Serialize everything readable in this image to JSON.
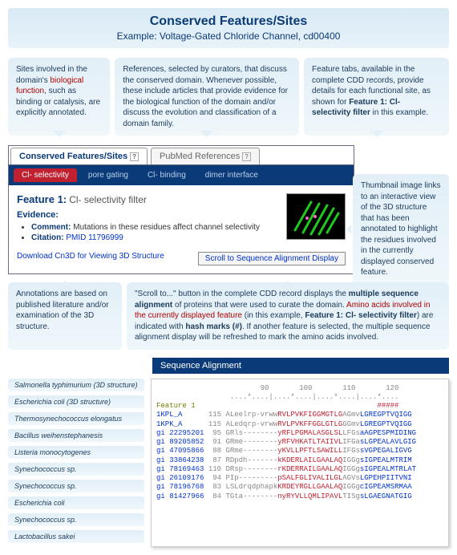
{
  "header": {
    "title": "Conserved Features/Sites",
    "subtitle": "Example: Voltage-Gated Chloride Channel, cd00400"
  },
  "callouts": {
    "top_left": {
      "pre": "Sites involved in the domain's ",
      "hl": "biological function",
      "post": ", such as binding or catalysis, are explicitly annotated."
    },
    "top_mid": "References, selected by curators, that discuss the conserved domain.  Whenever possible, these include articles that provide evidence for the biological function of the domain and/or discuss the evolution and classification of a domain family.",
    "top_right": {
      "pre": "Feature tabs, available in the complete CDD records, provide details for each functional site, as shown for ",
      "bold": "Feature 1: Cl- selectivity filter",
      "post": " in this example."
    },
    "thumb": "Thumbnail image links to an interactive view of the 3D structure that has been annotated to highlight the residues involved in the currently displayed conserved feature.",
    "mid_left": "Annotations are based on published literature and/or examination of the 3D structure.",
    "mid_right": "\"Scroll to...\"  button in the complete CDD record displays the multiple sequence alignment of proteins that were used to curate the domain.  Amino acids involved in the currently displayed feature (in this example, Feature 1: Cl- selectivity filter) are indicated with hash marks (#).  If another feature is selected, the multiple sequence alignment display will be refreshed to mark the amino acids involved."
  },
  "outer_tabs": [
    {
      "label": "Conserved Features/Sites",
      "active": true
    },
    {
      "label": "PubMed References",
      "active": false
    }
  ],
  "inner_tabs": [
    {
      "label": "Cl- selectivity",
      "active": true
    },
    {
      "label": "pore gating"
    },
    {
      "label": "Cl- binding"
    },
    {
      "label": "dimer interface"
    }
  ],
  "feature": {
    "label": "Feature 1:",
    "name": "Cl- selectivity filter",
    "evidence_label": "Evidence:",
    "comment_label": "Comment:",
    "comment": "Mutations in these residues affect channel selectivity",
    "citation_label": "Citation:",
    "citation": "PMID 11796999",
    "download_link": "Download Cn3D for Viewing 3D Structure",
    "scroll_button": "Scroll to Sequence Alignment Display"
  },
  "seq_band": "Sequence Alignment",
  "species": [
    "Salmonella typhimurium (3D structure)",
    "Escherichia coli (3D structure)",
    "Thermosynechococcus elongatus",
    "Bacillus weihenstephanesis",
    "Listeria monocytogenes",
    "Synechococcus sp.",
    "Synechococcus sp.",
    "Escherichia coli",
    "Synechococcus sp.",
    "Lactobacillus sakei"
  ],
  "alignment": {
    "ruler1": "                        90       100       110       120",
    "ruler2": "                 ....*....|....*....|....*....|....*....",
    "feat": "Feature 1                                          #####",
    "rows": [
      {
        "id": "1KPL_A     ",
        "pos": "115",
        "pre": "ALeelrp-vrww",
        "red": "RVLPVKFIGGMGTLG",
        "mid": "AGmv",
        "suf": "LGREGPTVQIGG"
      },
      {
        "id": "1KPK_A     ",
        "pos": "115",
        "pre": "ALedqrp-vrww",
        "red": "RVLPVKFFGGLGTLG",
        "mid": "GGmv",
        "suf": "LGREGPTVQIGG"
      },
      {
        "id": "gi 22295201",
        "pos": " 95",
        "pre": "GRls--------",
        "red": "yRFLPGMALASGLSL",
        "mid": "LFGs",
        "suf": "aAGPESPMIDING"
      },
      {
        "id": "gi 89205852",
        "pos": " 91",
        "pre": "GRme--------",
        "red": "yRFVHKATLTAIIVL",
        "mid": "IFGa",
        "suf": "sLGPEALAVLGIG"
      },
      {
        "id": "gi 47095866",
        "pos": " 88",
        "pre": "GRme--------",
        "red": "yKVLLPFTLSAWILL",
        "mid": "IFGs",
        "suf": "sVGPEGALIGVG"
      },
      {
        "id": "gi 33864238",
        "pos": " 87",
        "pre": "RDpdh-------",
        "red": "kKDERLAILGAALAQ",
        "mid": "IGGg",
        "suf": "sIGPEALMTRIM"
      },
      {
        "id": "gi 78169463",
        "pos": "110",
        "pre": "DRsp--------",
        "red": "rKDERRAILGAALAQ",
        "mid": "IGGg",
        "suf": "sIGPEALMTRLAT"
      },
      {
        "id": "gi 26109176",
        "pos": " 94",
        "pre": "PIp---------",
        "red": "pSALFGLIVALILGL",
        "mid": "AGVs",
        "suf": "LGPEHPIITVNI"
      },
      {
        "id": "gi 78196768",
        "pos": " 83",
        "pre": "LSLdrqdphapk",
        "red": "KRDEYRGLLGAALAQ",
        "mid": "IGGg",
        "suf": "cIGPEAMSRMAA"
      },
      {
        "id": "gi 81427966",
        "pos": " 84",
        "pre": "TGta--------",
        "red": "nyRYVLLQMLIPAVL",
        "mid": "TISg",
        "suf": "sLGAEGNATGIG"
      }
    ]
  }
}
